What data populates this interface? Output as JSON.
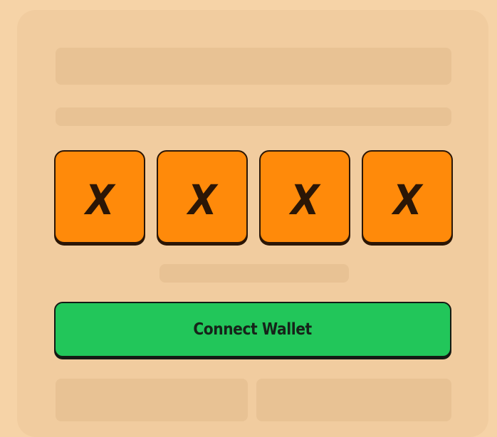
{
  "colors": {
    "background": "#f6d3a7",
    "card": "#f1cc9f",
    "tile": "#ff8a0a",
    "tile_text": "#2b1606",
    "primary_button": "#22c65a",
    "outline": "#141a14"
  },
  "tiles": [
    {
      "glyph": "X"
    },
    {
      "glyph": "X"
    },
    {
      "glyph": "X"
    },
    {
      "glyph": "X"
    }
  ],
  "connect_button": {
    "label": "Connect Wallet"
  }
}
